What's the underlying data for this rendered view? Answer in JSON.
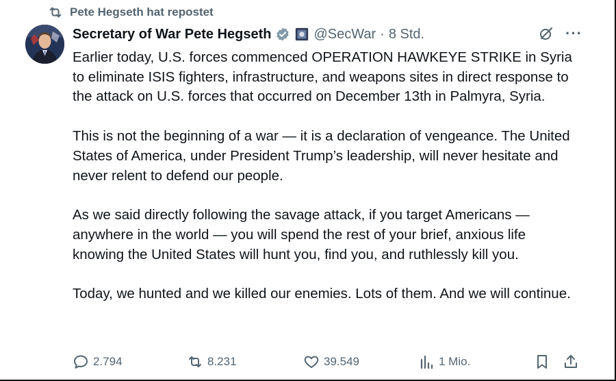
{
  "repost": {
    "text": "Pete Hegseth hat repostet",
    "icon": "repost-icon"
  },
  "tweet": {
    "author_name": "Secretary of War Pete Hegseth",
    "handle": "@SecWar",
    "separator": "·",
    "time": "8 Std.",
    "paragraphs": [
      "Earlier today, U.S. forces commenced OPERATION HAWKEYE STRIKE in Syria to eliminate ISIS fighters, infrastructure, and weapons sites in direct response to the attack on U.S. forces that occurred on December 13th in Palmyra, Syria.",
      "This is not the beginning of a war — it is a declaration of vengeance. The United States of America, under President Trump’s leadership, will never hesitate and never relent to defend our people.",
      "As we said directly following the savage attack, if you target Americans — anywhere in the world — you will spend the rest of your brief, anxious life knowing the United States will hunt you, find you, and ruthlessly kill you.",
      "Today, we hunted and we killed our enemies. Lots of them. And we will continue."
    ]
  },
  "actions": {
    "replies": "2.794",
    "reposts": "8.231",
    "likes": "39.549",
    "views": "1 Mio."
  },
  "colors": {
    "text": "#0f1419",
    "secondary": "#536471",
    "verified": "#829aab"
  }
}
